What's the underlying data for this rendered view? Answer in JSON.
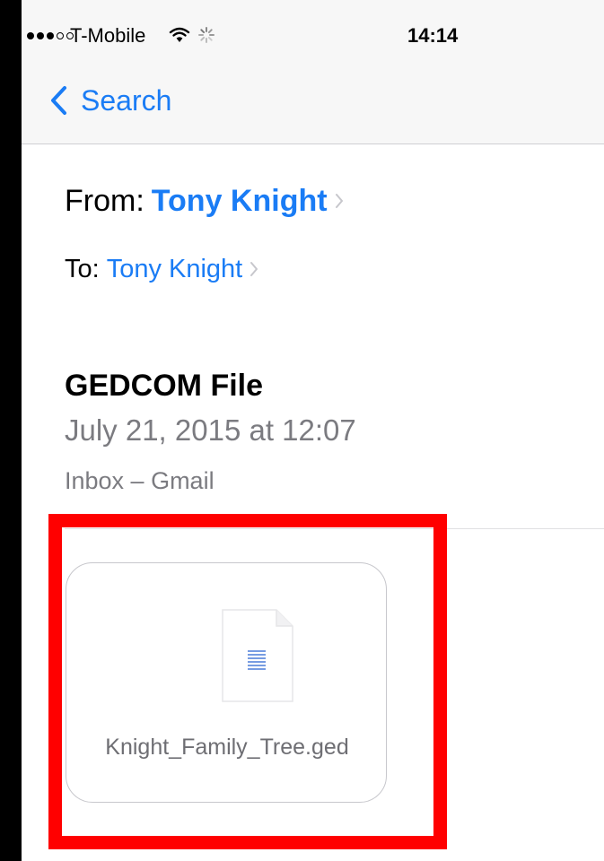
{
  "status_bar": {
    "carrier": "T-Mobile",
    "time": "14:14",
    "signal_strength": 3,
    "signal_max": 5,
    "icons": [
      "wifi-icon",
      "activity-icon"
    ]
  },
  "nav": {
    "back_label": "Search",
    "back_icon": "chevron-left-icon"
  },
  "message": {
    "from_label": "From:",
    "from_name": "Tony Knight",
    "to_label": "To:",
    "to_name": "Tony Knight",
    "subject": "GEDCOM File",
    "date": "July 21, 2015 at 12:07",
    "mailbox": "Inbox – Gmail"
  },
  "attachment": {
    "file_name": "Knight_Family_Tree.ged",
    "icon": "document-icon"
  },
  "colors": {
    "link_blue": "#1a7cf5",
    "secondary_gray": "#7b7b80",
    "highlight_red": "#ff0000"
  }
}
